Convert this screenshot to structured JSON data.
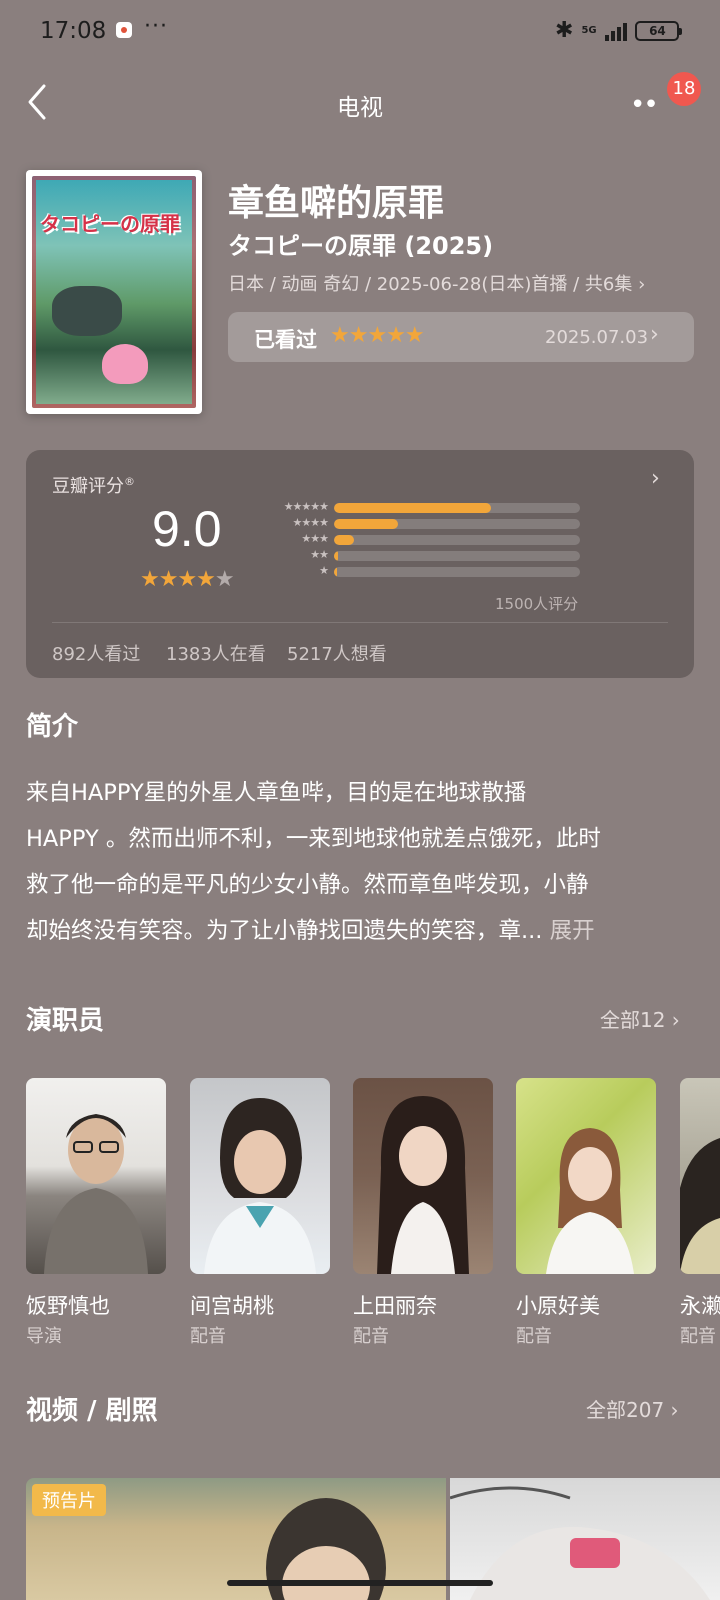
{
  "status_bar": {
    "time": "17:08",
    "dots": "···",
    "net": "5G",
    "battery": "64"
  },
  "nav": {
    "title": "电视",
    "badge": "18"
  },
  "movie": {
    "poster_text": "タコピーの原罪",
    "title_cn": "章鱼噼的原罪",
    "title_jp": "タコピーの原罪 (2025)",
    "meta": "日本 / 动画 奇幻 / 2025-06-28(日本)首播 / 共6集",
    "watched_label": "已看过",
    "watched_stars": "★★★★★",
    "watched_date": "2025.07.03"
  },
  "rating": {
    "label": "豆瓣评分",
    "reg_mark": "®",
    "score": "9.0",
    "stars_full": "★★★★",
    "stars_half": "★",
    "distribution": [
      {
        "stars": "★★★★★",
        "fraction": 0.64
      },
      {
        "stars": "★★★★",
        "fraction": 0.26
      },
      {
        "stars": "★★★",
        "fraction": 0.08
      },
      {
        "stars": "★★",
        "fraction": 0.015
      },
      {
        "stars": "★",
        "fraction": 0.01
      }
    ],
    "count": "1500人评分",
    "watched": "892人看过",
    "watching": "1383人在看",
    "want": "5217人想看"
  },
  "synopsis": {
    "title": "简介",
    "lines": [
      "来自HAPPY星的外星人章鱼哔，目的是在地球散播",
      "HAPPY 。然而出师不利，一来到地球他就差点饿死，此时",
      "救了他一命的是平凡的少女小静。然而章鱼哔发现，小静",
      "却始终没有笑容。为了让小静找回遗失的笑容，章..."
    ],
    "expand": "展开"
  },
  "cast": {
    "title": "演职员",
    "more": "全部12",
    "members": [
      {
        "name": "饭野慎也",
        "role": "导演"
      },
      {
        "name": "间宫胡桃",
        "role": "配音"
      },
      {
        "name": "上田丽奈",
        "role": "配音"
      },
      {
        "name": "小原好美",
        "role": "配音"
      },
      {
        "name": "永濑",
        "role": "配音"
      }
    ]
  },
  "videos": {
    "title": "视频 / 剧照",
    "more": "全部207",
    "trailer_tag": "预告片"
  },
  "colors": {
    "accent_star": "#f2a63a",
    "badge": "#f0584f",
    "background": "#8a7f7e"
  }
}
